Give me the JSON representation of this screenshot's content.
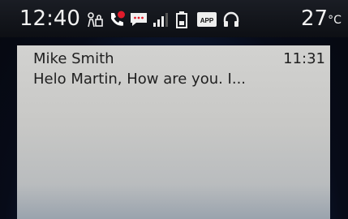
{
  "status_bar": {
    "time": "12:40",
    "temperature": "27",
    "temperature_unit": "°C",
    "icons": [
      "child-lock-icon",
      "missed-call-icon",
      "message-icon",
      "signal-bars-icon",
      "battery-icon",
      "app-icon",
      "headset-icon"
    ],
    "app_icon_text": "APP",
    "missed_call_color": "#e11b2b"
  },
  "notification": {
    "sender": "Mike Smith",
    "time": "11:31",
    "preview": "Helo Martin, How are you. I..."
  }
}
